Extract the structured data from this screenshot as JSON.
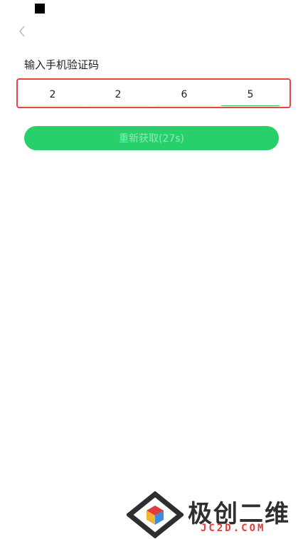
{
  "header": {
    "back_icon": "chevron-left-icon"
  },
  "title": "输入手机验证码",
  "code": {
    "digits": [
      "2",
      "2",
      "6",
      "5"
    ],
    "active_index": 3
  },
  "resend_label": "重新获取(27s)",
  "watermark": {
    "text_cn": "极创二维",
    "text_en": "JC2D.COM"
  },
  "colors": {
    "accent_green": "#27d06a",
    "highlight_red": "#e8453c"
  }
}
